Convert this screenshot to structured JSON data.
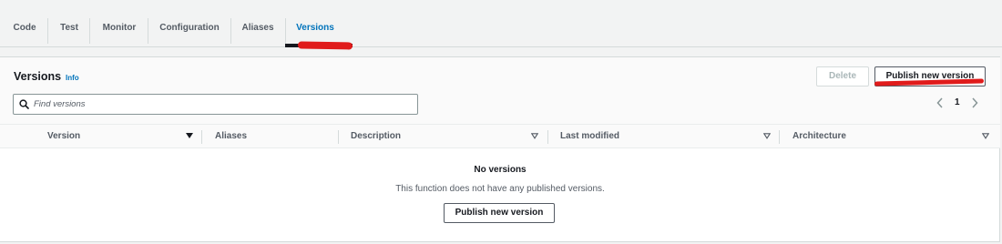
{
  "tabs": [
    {
      "label": "Code"
    },
    {
      "label": "Test"
    },
    {
      "label": "Monitor"
    },
    {
      "label": "Configuration"
    },
    {
      "label": "Aliases"
    },
    {
      "label": "Versions",
      "active": true
    }
  ],
  "panel": {
    "title": "Versions",
    "info_label": "Info",
    "delete_label": "Delete",
    "publish_label": "Publish new version"
  },
  "search": {
    "placeholder": "Find versions",
    "icon": "search-icon"
  },
  "pagination": {
    "current_page": "1",
    "prev_icon": "chevron-left-icon",
    "next_icon": "chevron-right-icon"
  },
  "table": {
    "columns": [
      {
        "label": "Version",
        "sort": "active-descending"
      },
      {
        "label": "Aliases",
        "sort": "none"
      },
      {
        "label": "Description",
        "sort": "sortable"
      },
      {
        "label": "Last modified",
        "sort": "sortable"
      },
      {
        "label": "Architecture",
        "sort": "sortable"
      }
    ]
  },
  "empty_state": {
    "title": "No versions",
    "description": "This function does not have any published versions.",
    "button_label": "Publish new version"
  },
  "colors": {
    "active_tab": "#0073bb",
    "link": "#0073bb",
    "annotation": "#e01b1b"
  }
}
